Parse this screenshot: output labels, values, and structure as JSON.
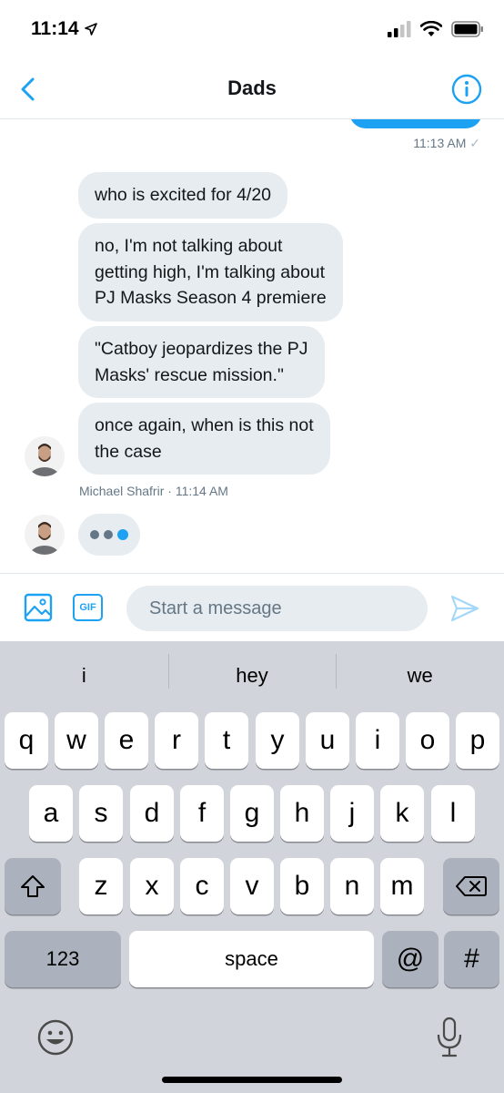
{
  "status_bar": {
    "time": "11:14"
  },
  "header": {
    "title": "Dads"
  },
  "conversation": {
    "last_sent_time": "11:13 AM",
    "received_messages": [
      {
        "text": "who is excited for 4/20"
      },
      {
        "text": "no, I'm not talking about\ngetting high, I'm talking about\nPJ Masks Season 4 premiere"
      },
      {
        "text": "\"Catboy jeopardizes the PJ\nMasks' rescue mission.\""
      },
      {
        "text": "once again, when is this not\nthe case"
      }
    ],
    "sender_name": "Michael Shafrir",
    "sender_time": "11:14 AM"
  },
  "composer": {
    "gif_label": "GIF",
    "placeholder": "Start a message"
  },
  "keyboard": {
    "suggestions": [
      "i",
      "hey",
      "we"
    ],
    "row1": [
      "q",
      "w",
      "e",
      "r",
      "t",
      "y",
      "u",
      "i",
      "o",
      "p"
    ],
    "row2": [
      "a",
      "s",
      "d",
      "f",
      "g",
      "h",
      "j",
      "k",
      "l"
    ],
    "row3": [
      "z",
      "x",
      "c",
      "v",
      "b",
      "n",
      "m"
    ],
    "numbers_label": "123",
    "space_label": "space",
    "at_label": "@",
    "hash_label": "#"
  },
  "colors": {
    "accent": "#1da1f2",
    "bubble_received": "#e6ecf0",
    "keyboard_bg": "#d1d4db"
  }
}
